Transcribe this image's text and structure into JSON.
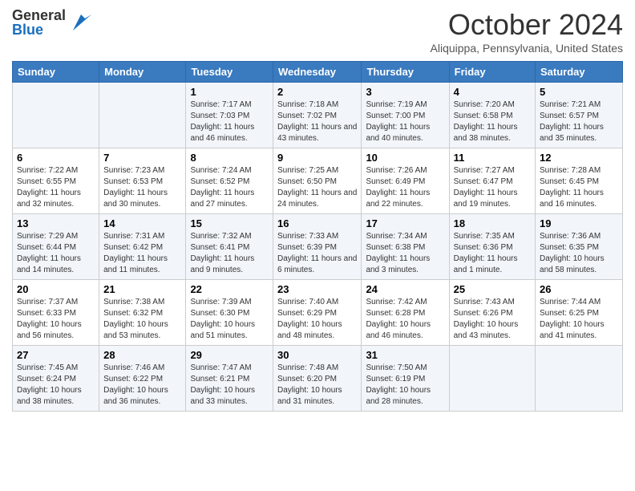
{
  "header": {
    "logo_general": "General",
    "logo_blue": "Blue",
    "month_title": "October 2024",
    "location": "Aliquippa, Pennsylvania, United States"
  },
  "days_of_week": [
    "Sunday",
    "Monday",
    "Tuesday",
    "Wednesday",
    "Thursday",
    "Friday",
    "Saturday"
  ],
  "weeks": [
    [
      {
        "day": "",
        "sunrise": "",
        "sunset": "",
        "daylight": ""
      },
      {
        "day": "",
        "sunrise": "",
        "sunset": "",
        "daylight": ""
      },
      {
        "day": "1",
        "sunrise": "Sunrise: 7:17 AM",
        "sunset": "Sunset: 7:03 PM",
        "daylight": "Daylight: 11 hours and 46 minutes."
      },
      {
        "day": "2",
        "sunrise": "Sunrise: 7:18 AM",
        "sunset": "Sunset: 7:02 PM",
        "daylight": "Daylight: 11 hours and 43 minutes."
      },
      {
        "day": "3",
        "sunrise": "Sunrise: 7:19 AM",
        "sunset": "Sunset: 7:00 PM",
        "daylight": "Daylight: 11 hours and 40 minutes."
      },
      {
        "day": "4",
        "sunrise": "Sunrise: 7:20 AM",
        "sunset": "Sunset: 6:58 PM",
        "daylight": "Daylight: 11 hours and 38 minutes."
      },
      {
        "day": "5",
        "sunrise": "Sunrise: 7:21 AM",
        "sunset": "Sunset: 6:57 PM",
        "daylight": "Daylight: 11 hours and 35 minutes."
      }
    ],
    [
      {
        "day": "6",
        "sunrise": "Sunrise: 7:22 AM",
        "sunset": "Sunset: 6:55 PM",
        "daylight": "Daylight: 11 hours and 32 minutes."
      },
      {
        "day": "7",
        "sunrise": "Sunrise: 7:23 AM",
        "sunset": "Sunset: 6:53 PM",
        "daylight": "Daylight: 11 hours and 30 minutes."
      },
      {
        "day": "8",
        "sunrise": "Sunrise: 7:24 AM",
        "sunset": "Sunset: 6:52 PM",
        "daylight": "Daylight: 11 hours and 27 minutes."
      },
      {
        "day": "9",
        "sunrise": "Sunrise: 7:25 AM",
        "sunset": "Sunset: 6:50 PM",
        "daylight": "Daylight: 11 hours and 24 minutes."
      },
      {
        "day": "10",
        "sunrise": "Sunrise: 7:26 AM",
        "sunset": "Sunset: 6:49 PM",
        "daylight": "Daylight: 11 hours and 22 minutes."
      },
      {
        "day": "11",
        "sunrise": "Sunrise: 7:27 AM",
        "sunset": "Sunset: 6:47 PM",
        "daylight": "Daylight: 11 hours and 19 minutes."
      },
      {
        "day": "12",
        "sunrise": "Sunrise: 7:28 AM",
        "sunset": "Sunset: 6:45 PM",
        "daylight": "Daylight: 11 hours and 16 minutes."
      }
    ],
    [
      {
        "day": "13",
        "sunrise": "Sunrise: 7:29 AM",
        "sunset": "Sunset: 6:44 PM",
        "daylight": "Daylight: 11 hours and 14 minutes."
      },
      {
        "day": "14",
        "sunrise": "Sunrise: 7:31 AM",
        "sunset": "Sunset: 6:42 PM",
        "daylight": "Daylight: 11 hours and 11 minutes."
      },
      {
        "day": "15",
        "sunrise": "Sunrise: 7:32 AM",
        "sunset": "Sunset: 6:41 PM",
        "daylight": "Daylight: 11 hours and 9 minutes."
      },
      {
        "day": "16",
        "sunrise": "Sunrise: 7:33 AM",
        "sunset": "Sunset: 6:39 PM",
        "daylight": "Daylight: 11 hours and 6 minutes."
      },
      {
        "day": "17",
        "sunrise": "Sunrise: 7:34 AM",
        "sunset": "Sunset: 6:38 PM",
        "daylight": "Daylight: 11 hours and 3 minutes."
      },
      {
        "day": "18",
        "sunrise": "Sunrise: 7:35 AM",
        "sunset": "Sunset: 6:36 PM",
        "daylight": "Daylight: 11 hours and 1 minute."
      },
      {
        "day": "19",
        "sunrise": "Sunrise: 7:36 AM",
        "sunset": "Sunset: 6:35 PM",
        "daylight": "Daylight: 10 hours and 58 minutes."
      }
    ],
    [
      {
        "day": "20",
        "sunrise": "Sunrise: 7:37 AM",
        "sunset": "Sunset: 6:33 PM",
        "daylight": "Daylight: 10 hours and 56 minutes."
      },
      {
        "day": "21",
        "sunrise": "Sunrise: 7:38 AM",
        "sunset": "Sunset: 6:32 PM",
        "daylight": "Daylight: 10 hours and 53 minutes."
      },
      {
        "day": "22",
        "sunrise": "Sunrise: 7:39 AM",
        "sunset": "Sunset: 6:30 PM",
        "daylight": "Daylight: 10 hours and 51 minutes."
      },
      {
        "day": "23",
        "sunrise": "Sunrise: 7:40 AM",
        "sunset": "Sunset: 6:29 PM",
        "daylight": "Daylight: 10 hours and 48 minutes."
      },
      {
        "day": "24",
        "sunrise": "Sunrise: 7:42 AM",
        "sunset": "Sunset: 6:28 PM",
        "daylight": "Daylight: 10 hours and 46 minutes."
      },
      {
        "day": "25",
        "sunrise": "Sunrise: 7:43 AM",
        "sunset": "Sunset: 6:26 PM",
        "daylight": "Daylight: 10 hours and 43 minutes."
      },
      {
        "day": "26",
        "sunrise": "Sunrise: 7:44 AM",
        "sunset": "Sunset: 6:25 PM",
        "daylight": "Daylight: 10 hours and 41 minutes."
      }
    ],
    [
      {
        "day": "27",
        "sunrise": "Sunrise: 7:45 AM",
        "sunset": "Sunset: 6:24 PM",
        "daylight": "Daylight: 10 hours and 38 minutes."
      },
      {
        "day": "28",
        "sunrise": "Sunrise: 7:46 AM",
        "sunset": "Sunset: 6:22 PM",
        "daylight": "Daylight: 10 hours and 36 minutes."
      },
      {
        "day": "29",
        "sunrise": "Sunrise: 7:47 AM",
        "sunset": "Sunset: 6:21 PM",
        "daylight": "Daylight: 10 hours and 33 minutes."
      },
      {
        "day": "30",
        "sunrise": "Sunrise: 7:48 AM",
        "sunset": "Sunset: 6:20 PM",
        "daylight": "Daylight: 10 hours and 31 minutes."
      },
      {
        "day": "31",
        "sunrise": "Sunrise: 7:50 AM",
        "sunset": "Sunset: 6:19 PM",
        "daylight": "Daylight: 10 hours and 28 minutes."
      },
      {
        "day": "",
        "sunrise": "",
        "sunset": "",
        "daylight": ""
      },
      {
        "day": "",
        "sunrise": "",
        "sunset": "",
        "daylight": ""
      }
    ]
  ]
}
